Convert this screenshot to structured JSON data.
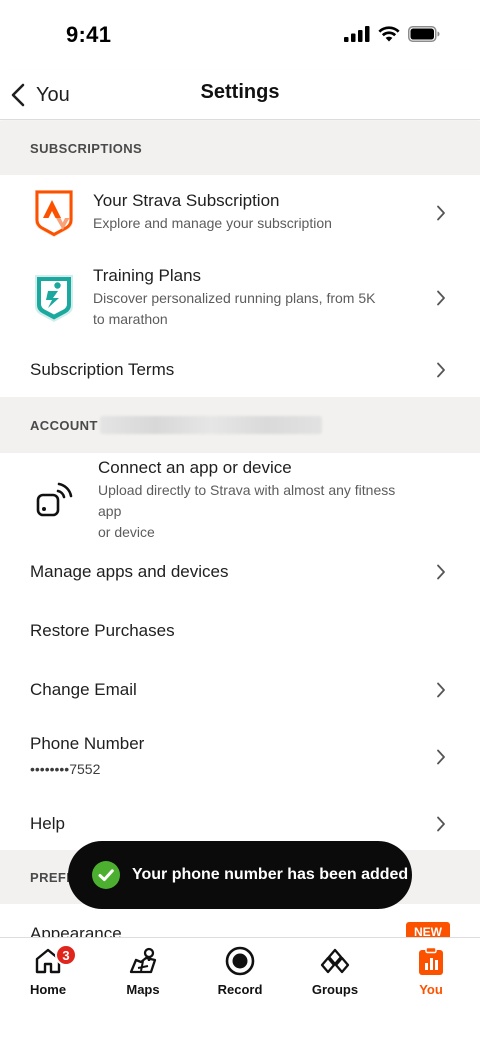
{
  "status_bar": {
    "time": "9:41"
  },
  "nav": {
    "back_label": "You",
    "title": "Settings"
  },
  "sections": {
    "subscriptions": {
      "header": "SUBSCRIPTIONS",
      "items": [
        {
          "title": "Your Strava Subscription",
          "subtitle": "Explore and manage your subscription"
        },
        {
          "title": "Training Plans",
          "subtitle_line1": "Discover personalized running plans, from 5K",
          "subtitle_line2": "to marathon"
        },
        {
          "title": "Subscription Terms"
        }
      ]
    },
    "account": {
      "header": "ACCOUNT",
      "items": [
        {
          "title": "Connect an app or device",
          "subtitle_line1": "Upload directly to Strava with almost any fitness app",
          "subtitle_line2": "or device"
        },
        {
          "title": "Manage apps and devices"
        },
        {
          "title": "Restore Purchases"
        },
        {
          "title": "Change Email"
        },
        {
          "title": "Phone Number",
          "value": "••••••••7552"
        },
        {
          "title": "Help"
        }
      ]
    },
    "preferences": {
      "header_partial": "PREFE",
      "first_item_partial": "Appearance",
      "new_badge": "NEW"
    }
  },
  "toast": {
    "message": "Your phone number has been added"
  },
  "tab_bar": {
    "tabs": [
      {
        "label": "Home",
        "badge": "3"
      },
      {
        "label": "Maps"
      },
      {
        "label": "Record"
      },
      {
        "label": "Groups"
      },
      {
        "label": "You"
      }
    ]
  },
  "colors": {
    "brand_orange": "#fc5200",
    "teal": "#1ba89e",
    "badge_red": "#e0261c",
    "toast_bg": "#0b0b0b",
    "success_green": "#4caf2f"
  }
}
